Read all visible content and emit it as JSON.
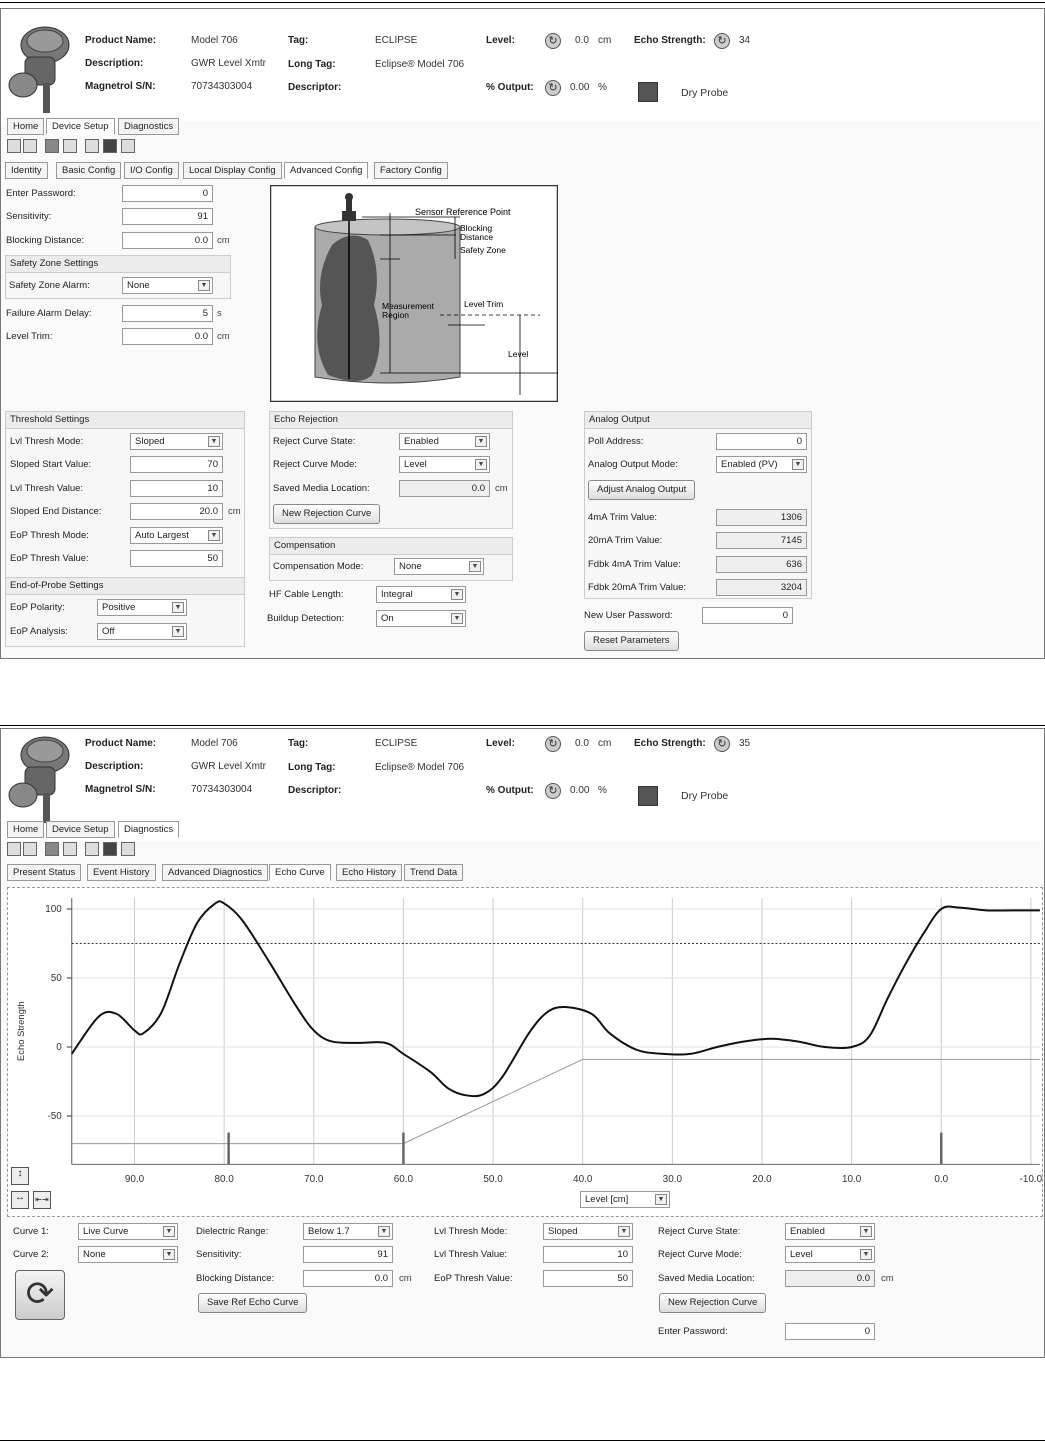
{
  "header": {
    "product_name_label": "Product Name:",
    "product_name": "Model 706",
    "description_label": "Description:",
    "description": "GWR Level Xmtr",
    "serial_label": "Magnetrol S/N:",
    "serial": "70734303004",
    "tag_label": "Tag:",
    "tag": "ECLIPSE",
    "long_tag_label": "Long Tag:",
    "long_tag": "Eclipse® Model 706",
    "descriptor_label": "Descriptor:",
    "level_label": "Level:",
    "level_value": "0.0",
    "level_unit": "cm",
    "output_label": "% Output:",
    "output_value": "0.00",
    "output_unit": "%",
    "echo_label": "Echo Strength:",
    "echo_value_1": "34",
    "echo_value_2": "35",
    "status_text": "Dry Probe",
    "status_color": "#555555"
  },
  "main_tabs": [
    "Home",
    "Device Setup",
    "Diagnostics"
  ],
  "panel1": {
    "sub_tabs": [
      "Identity",
      "Basic Config",
      "I/O Config",
      "Local Display Config",
      "Advanced Config",
      "Factory Config"
    ],
    "enter_password_label": "Enter Password:",
    "enter_password": "0",
    "sensitivity_label": "Sensitivity:",
    "sensitivity": "91",
    "blocking_distance_label": "Blocking Distance:",
    "blocking_distance": "0.0",
    "unit_cm": "cm",
    "unit_s": "s",
    "safety_zone_settings": "Safety Zone Settings",
    "safety_zone_alarm_label": "Safety Zone Alarm:",
    "safety_zone_alarm": "None",
    "failure_alarm_delay_label": "Failure Alarm Delay:",
    "failure_alarm_delay": "5",
    "level_trim_label": "Level Trim:",
    "level_trim": "0.0",
    "diagram": {
      "sensor_reference_point": "Sensor Reference Point",
      "blocking": "Blocking",
      "distance": "Distance",
      "safety_zone": "Safety Zone",
      "measurement": "Measurement",
      "region": "Region",
      "level_trim": "Level Trim",
      "level": "Level"
    },
    "threshold_settings": "Threshold Settings",
    "lvl_thresh_mode_label": "Lvl Thresh Mode:",
    "lvl_thresh_mode": "Sloped",
    "sloped_start_value_label": "Sloped Start Value:",
    "sloped_start_value": "70",
    "lvl_thresh_value_label": "Lvl Thresh Value:",
    "lvl_thresh_value": "10",
    "sloped_end_distance_label": "Sloped End Distance:",
    "sloped_end_distance": "20.0",
    "eop_thresh_mode_label": "EoP Thresh Mode:",
    "eop_thresh_mode": "Auto Largest",
    "eop_thresh_value_label": "EoP Thresh Value:",
    "eop_thresh_value": "50",
    "end_of_probe_settings": "End-of-Probe Settings",
    "eop_polarity_label": "EoP Polarity:",
    "eop_polarity": "Positive",
    "eop_analysis_label": "EoP Analysis:",
    "eop_analysis": "Off",
    "echo_rejection": "Echo Rejection",
    "reject_curve_state_label": "Reject Curve State:",
    "reject_curve_state": "Enabled",
    "reject_curve_mode_label": "Reject Curve Mode:",
    "reject_curve_mode": "Level",
    "saved_media_location_label": "Saved Media Location:",
    "saved_media_location": "0.0",
    "new_rejection_curve": "New Rejection Curve",
    "compensation": "Compensation",
    "compensation_mode_label": "Compensation Mode:",
    "compensation_mode": "None",
    "hf_cable_length_label": "HF Cable Length:",
    "hf_cable_length": "Integral",
    "buildup_detection_label": "Buildup Detection:",
    "buildup_detection": "On",
    "analog_output": "Analog Output",
    "poll_address_label": "Poll Address:",
    "poll_address": "0",
    "analog_output_mode_label": "Analog Output Mode:",
    "analog_output_mode": "Enabled (PV)",
    "adjust_analog_output": "Adjust Analog Output",
    "ma4_trim_label": "4mA Trim Value:",
    "ma4_trim": "1306",
    "ma20_trim_label": "20mA Trim Value:",
    "ma20_trim": "7145",
    "fdbk4_label": "Fdbk 4mA Trim Value:",
    "fdbk4": "636",
    "fdbk20_label": "Fdbk 20mA Trim Value:",
    "fdbk20": "3204",
    "new_user_password_label": "New User Password:",
    "new_user_password": "0",
    "reset_parameters": "Reset Parameters"
  },
  "panel2": {
    "sub_tabs": [
      "Present Status",
      "Event History",
      "Advanced Diagnostics",
      "Echo Curve",
      "Echo History",
      "Trend Data"
    ],
    "axis_select": "Level [cm]",
    "curve1_label": "Curve 1:",
    "curve1": "Live Curve",
    "curve2_label": "Curve 2:",
    "curve2": "None",
    "dielectric_range_label": "Dielectric Range:",
    "dielectric_range": "Below 1.7",
    "sensitivity_label": "Sensitivity:",
    "sensitivity": "91",
    "blocking_distance_label": "Blocking Distance:",
    "blocking_distance": "0.0",
    "unit_cm": "cm",
    "save_ref_echo_curve": "Save Ref Echo Curve",
    "lvl_thresh_mode_label": "Lvl Thresh Mode:",
    "lvl_thresh_mode": "Sloped",
    "lvl_thresh_value_label": "Lvl Thresh Value:",
    "lvl_thresh_value": "10",
    "eop_thresh_value_label": "EoP Thresh Value:",
    "eop_thresh_value": "50",
    "reject_curve_state_label": "Reject Curve State:",
    "reject_curve_state": "Enabled",
    "reject_curve_mode_label": "Reject Curve Mode:",
    "reject_curve_mode": "Level",
    "saved_media_location_label": "Saved Media Location:",
    "saved_media_location": "0.0",
    "new_rejection_curve": "New Rejection Curve",
    "enter_password_label": "Enter Password:",
    "enter_password": "0"
  },
  "chart_data": {
    "type": "line",
    "ylabel": "Echo Strength",
    "xlabel": "",
    "xlim": [
      97,
      -11
    ],
    "ylim": [
      -85,
      108
    ],
    "x_ticks": [
      "90.0",
      "80.0",
      "70.0",
      "60.0",
      "50.0",
      "40.0",
      "30.0",
      "20.0",
      "10.0",
      "0.0",
      "-10.0"
    ],
    "x_tick_values": [
      90,
      80,
      70,
      60,
      50,
      40,
      30,
      20,
      10,
      0,
      -10
    ],
    "y_ticks": [
      "100",
      "50",
      "0",
      "-50"
    ],
    "y_tick_values": [
      100,
      50,
      0,
      -50
    ],
    "eop_threshold": 75,
    "series": [
      {
        "values": [
          [
            97,
            -5
          ],
          [
            94,
            22
          ],
          [
            92,
            24
          ],
          [
            90,
            12
          ],
          [
            89,
            10
          ],
          [
            87,
            25
          ],
          [
            85,
            60
          ],
          [
            83,
            90
          ],
          [
            81,
            104
          ],
          [
            80,
            104
          ],
          [
            78,
            92
          ],
          [
            75,
            62
          ],
          [
            72,
            30
          ],
          [
            70,
            12
          ],
          [
            68,
            4
          ],
          [
            65,
            3
          ],
          [
            62,
            3
          ],
          [
            60,
            -5
          ],
          [
            57,
            -18
          ],
          [
            55,
            -30
          ],
          [
            53,
            -35
          ],
          [
            51,
            -34
          ],
          [
            49,
            -22
          ],
          [
            46,
            10
          ],
          [
            44,
            25
          ],
          [
            42,
            29
          ],
          [
            39,
            24
          ],
          [
            37,
            10
          ],
          [
            34,
            -2
          ],
          [
            31,
            -5
          ],
          [
            28,
            -5
          ],
          [
            25,
            0
          ],
          [
            22,
            4
          ],
          [
            19,
            6
          ],
          [
            16,
            4
          ],
          [
            13,
            0
          ],
          [
            10,
            0
          ],
          [
            8,
            8
          ],
          [
            6,
            35
          ],
          [
            4,
            60
          ],
          [
            2,
            82
          ],
          [
            0,
            100
          ],
          [
            -2,
            101
          ],
          [
            -5,
            99
          ],
          [
            -8,
            99
          ],
          [
            -11,
            99
          ]
        ]
      },
      {
        "values": [
          [
            97,
            -70
          ],
          [
            60,
            -70
          ],
          [
            40,
            -9
          ],
          [
            -11,
            -9
          ]
        ]
      }
    ],
    "markers": [
      79.5,
      60,
      0
    ]
  }
}
